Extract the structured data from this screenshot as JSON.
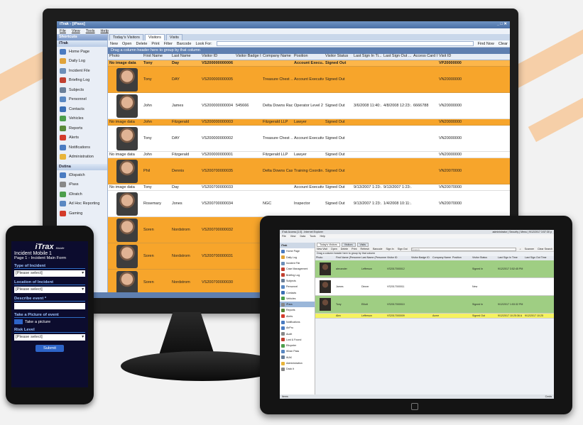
{
  "monitor": {
    "title": "iTrak - [iPass]",
    "menu": [
      "File",
      "View",
      "Tools",
      "Help"
    ],
    "sidebar": {
      "shortcuts_label": "Shortcuts",
      "section1": "iTrak",
      "items1": [
        {
          "label": "Home Page",
          "color": "#4a7bc1"
        },
        {
          "label": "Daily Log",
          "color": "#e0a33a"
        },
        {
          "label": "Incident File",
          "color": "#6d8fb8"
        },
        {
          "label": "Briefing Log",
          "color": "#c04030"
        },
        {
          "label": "Subjects",
          "color": "#6a7f99"
        },
        {
          "label": "Personnel",
          "color": "#5a88c2"
        },
        {
          "label": "Contacts",
          "color": "#3b6fb5"
        },
        {
          "label": "Vehicles",
          "color": "#4c9e4c"
        },
        {
          "label": "Reports",
          "color": "#5a8a3a"
        },
        {
          "label": "Alerts",
          "color": "#d33b2b"
        },
        {
          "label": "Notifications",
          "color": "#4a7bc1"
        },
        {
          "label": "Administration",
          "color": "#e8b43a"
        }
      ],
      "section2": "Dstina",
      "items2": [
        {
          "label": "iDispatch",
          "color": "#4a7bc1"
        },
        {
          "label": "iPass",
          "color": "#888888"
        },
        {
          "label": "iDiratch",
          "color": "#4c9e4c"
        },
        {
          "label": "Ad Hoc Reporting",
          "color": "#5a88c2"
        },
        {
          "label": "Gaming",
          "color": "#d33b2b"
        }
      ]
    },
    "tabs": [
      "Today's Visitors",
      "Visitors",
      "Visits"
    ],
    "toolbar": [
      "New",
      "Open",
      "Delete",
      "Print",
      "Filter",
      "Barcode"
    ],
    "lookup_label": "Look For:",
    "find_now": "Find Now",
    "clear": "Clear",
    "group_hint": "Drag a column header here to group by that column",
    "columns": [
      "Photo",
      "First Name",
      "Last Name",
      "Visitor ID",
      "Visitor Badge ID",
      "Company Name",
      "Position",
      "Visitor Status",
      "Last Sign In Ti...",
      "Last Sign Out ...",
      "Access Card I...",
      "Visit ID"
    ],
    "rows": [
      {
        "style": "hl",
        "photo": "No image data",
        "first": "Tony",
        "last": "Day",
        "vid": "VS200000000006",
        "badge": "",
        "company": "",
        "position": "Account Execu...",
        "status": "Signed Out",
        "in": "",
        "out": "",
        "card": "",
        "visit": "VP20000000"
      },
      {
        "style": "orange",
        "photo": "img",
        "first": "Tony",
        "last": "DAY",
        "vid": "VS200000000005",
        "badge": "",
        "company": "Treasure Chest ...",
        "position": "Account Executive",
        "status": "Signed Out",
        "in": "",
        "out": "",
        "card": "",
        "visit": "VN20000000"
      },
      {
        "style": "white",
        "photo": "img",
        "first": "John",
        "last": "James",
        "vid": "VS200000000004",
        "badge": "545666",
        "company": "Delta Downs Rac...",
        "position": "Operator Level 2",
        "status": "Signed Out",
        "in": "3/6/2008 11:40:...",
        "out": "4/8/2008 12:23:...",
        "card": "6666788",
        "visit": "VN20000000"
      },
      {
        "style": "orange",
        "photo": "No image data",
        "first": "John",
        "last": "Fitzgerald",
        "vid": "VS200000000003",
        "badge": "",
        "company": "Fitzgerald LLP",
        "position": "Lawyer",
        "status": "Signed Out",
        "in": "",
        "out": "",
        "card": "",
        "visit": "VN20000000"
      },
      {
        "style": "white",
        "photo": "img",
        "first": "Tony",
        "last": "DAY",
        "vid": "VS200000000002",
        "badge": "",
        "company": "Treasure Chest ...",
        "position": "Account Executive",
        "status": "Signed Out",
        "in": "",
        "out": "",
        "card": "",
        "visit": "VN20000000"
      },
      {
        "style": "white",
        "photo": "No image data",
        "first": "John",
        "last": "Fitzgerald",
        "vid": "VS200000000001",
        "badge": "",
        "company": "Fitzgerald LLP",
        "position": "Lawyer",
        "status": "Signed Out",
        "in": "",
        "out": "",
        "card": "",
        "visit": "VN20000000"
      },
      {
        "style": "orange",
        "photo": "img",
        "first": "Phil",
        "last": "Dennis",
        "vid": "VS200700000035",
        "badge": "",
        "company": "Delta Downs Cas...",
        "position": "Training Coordin...",
        "status": "Signed Out",
        "in": "",
        "out": "",
        "card": "",
        "visit": "VN20070000"
      },
      {
        "style": "white",
        "photo": "No image data",
        "first": "Tony",
        "last": "Day",
        "vid": "VS200700000033",
        "badge": "",
        "company": "",
        "position": "Account Executive",
        "status": "Signed Out",
        "in": "9/13/2007 1:23:...",
        "out": "9/13/2007 1:23:...",
        "card": "",
        "visit": "VN20070000"
      },
      {
        "style": "white",
        "photo": "img",
        "first": "Rosemary",
        "last": "Jones",
        "vid": "VS200700000034",
        "badge": "",
        "company": "NGC",
        "position": "Inspector",
        "status": "Signed Out",
        "in": "9/13/2007 1:23:...",
        "out": "1/4/2008 10:11:...",
        "card": "",
        "visit": "VN20070000"
      },
      {
        "style": "orange",
        "photo": "img",
        "first": "Soren",
        "last": "Nordstrom",
        "vid": "VS200700000032",
        "badge": "",
        "company": "",
        "position": "",
        "status": "",
        "in": "",
        "out": "",
        "card": "",
        "visit": ""
      },
      {
        "style": "orange",
        "photo": "img",
        "first": "Soren",
        "last": "Nordstrom",
        "vid": "VS200700000031",
        "badge": "",
        "company": "",
        "position": "",
        "status": "",
        "in": "",
        "out": "",
        "card": "",
        "visit": ""
      },
      {
        "style": "orange",
        "photo": "img",
        "first": "Soren",
        "last": "Nordstrom",
        "vid": "VS200700000030",
        "badge": "",
        "company": "",
        "position": "",
        "status": "",
        "in": "",
        "out": "",
        "card": "",
        "visit": ""
      }
    ],
    "status": "Alerts"
  },
  "phone": {
    "logo": "iTrax",
    "logo_sub": "Mobile",
    "title": "Incident Mobile 1",
    "subtitle": "Page 1 - Incident Main Form",
    "type_label": "Type of Incident",
    "type_value": "[Please select]",
    "location_label": "Location of Incident",
    "location_value": "[Please select]",
    "describe_label": "Describe event *",
    "picture_label": "Take a Picture of event",
    "picture_button": "Take a picture",
    "risk_label": "Risk Level",
    "risk_value": "[Please select]",
    "submit": "Submit"
  },
  "tablet": {
    "title": "iTrak Access [1.0] - Internet Explorer",
    "user_links": [
      "administrator",
      "Security",
      "Menu",
      "9/12/2017 3:57:30 p"
    ],
    "menu": [
      "File",
      "View",
      "Data",
      "Tools",
      "Help"
    ],
    "sidebar_head": "iTrak",
    "items": [
      {
        "label": "Home Page",
        "color": "#4a7bc1"
      },
      {
        "label": "Daily Log",
        "color": "#e0a33a"
      },
      {
        "label": "Incident File",
        "color": "#6d8fb8"
      },
      {
        "label": "Case Management",
        "color": "#c04030"
      },
      {
        "label": "Briefing Log",
        "color": "#c04030"
      },
      {
        "label": "Subjects",
        "color": "#6a7f99"
      },
      {
        "label": "Personnel",
        "color": "#5a88c2"
      },
      {
        "label": "Contacts",
        "color": "#3b6fb5"
      },
      {
        "label": "Vehicles",
        "color": "#4c9e4c"
      },
      {
        "label": "iPass",
        "color": "#888888"
      },
      {
        "label": "Reports",
        "color": "#5a8a3a"
      },
      {
        "label": "Alerts",
        "color": "#d33b2b"
      },
      {
        "label": "Notifications",
        "color": "#4a7bc1"
      },
      {
        "label": "AirPro",
        "color": "#4a7bc1"
      },
      {
        "label": "Audit",
        "color": "#888888"
      },
      {
        "label": "Lost & Found",
        "color": "#c04030"
      },
      {
        "label": "Eticpeter",
        "color": "#4c9e4c"
      },
      {
        "label": "iKhan Pass",
        "color": "#5a88c2"
      },
      {
        "label": "iKAK",
        "color": "#6a7f99"
      },
      {
        "label": "Administration",
        "color": "#e8b43a"
      },
      {
        "label": "Dack It",
        "color": "#888888"
      }
    ],
    "tabs": [
      "Today's Visitors",
      "Visitors",
      "Visits"
    ],
    "toolbar": [
      "New Visit",
      "Open",
      "Delete",
      "Print",
      "Refresh",
      "Barcode",
      "Sign In",
      "Sign Out"
    ],
    "search_placeholder": "Search",
    "scanner": "Scanner",
    "clear_search": "Clear Search",
    "group_hint": "Drag a column header here to group by that column",
    "columns": [
      "Photo",
      "First Name (Personne",
      "Last Name (Personne",
      "Visitor ID",
      "Visitor Badge ID",
      "Company Name",
      "Position",
      "Visitor Status",
      "Last Sign In Time",
      "Last Sign Out Time"
    ],
    "rows": [
      {
        "style": "green",
        "first": "alexander",
        "last": "Lefferson",
        "vid": "VS2017000012",
        "status": "Signed In",
        "in": "9/12/2017 3:52:45 PM",
        "out": ""
      },
      {
        "style": "white",
        "first": "James",
        "last": "Dinner",
        "vid": "VS2017000011",
        "status": "New",
        "in": "",
        "out": ""
      },
      {
        "style": "green",
        "first": "Tony",
        "last": "Elliott",
        "vid": "VS2017000010",
        "status": "Signed In",
        "in": "9/12/2017 1:53:32 PM",
        "out": ""
      },
      {
        "style": "yellow",
        "first": "Alex",
        "last": "Lefferson",
        "vid": "VS2017000009",
        "company": "Acme",
        "status": "Signed Out",
        "in": "9/12/2017 10:25:36 A",
        "out": "9/12/2017 10:25"
      }
    ],
    "status_left": "Items",
    "status_right": "Cmds"
  }
}
